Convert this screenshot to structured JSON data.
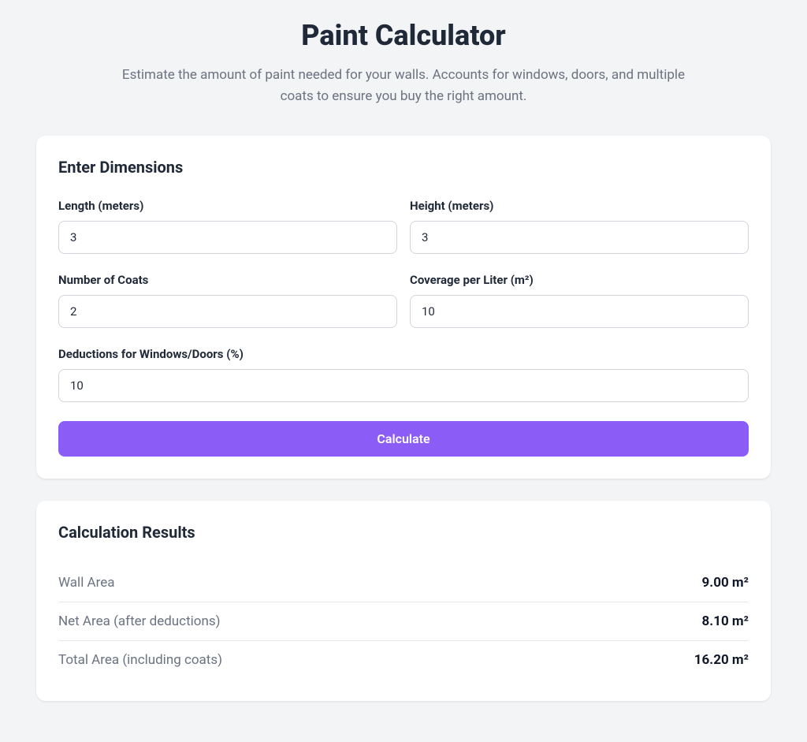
{
  "header": {
    "title": "Paint Calculator",
    "subtitle": "Estimate the amount of paint needed for your walls. Accounts for windows, doors, and multiple coats to ensure you buy the right amount."
  },
  "form": {
    "section_title": "Enter Dimensions",
    "fields": {
      "length": {
        "label": "Length (meters)",
        "value": "3"
      },
      "height": {
        "label": "Height (meters)",
        "value": "3"
      },
      "coats": {
        "label": "Number of Coats",
        "value": "2"
      },
      "coverage": {
        "label": "Coverage per Liter (m²)",
        "value": "10"
      },
      "deductions": {
        "label": "Deductions for Windows/Doors (%)",
        "value": "10"
      }
    },
    "calculate_label": "Calculate"
  },
  "results": {
    "section_title": "Calculation Results",
    "rows": [
      {
        "label": "Wall Area",
        "value": "9.00 m²"
      },
      {
        "label": "Net Area (after deductions)",
        "value": "8.10 m²"
      },
      {
        "label": "Total Area (including coats)",
        "value": "16.20 m²"
      }
    ]
  }
}
